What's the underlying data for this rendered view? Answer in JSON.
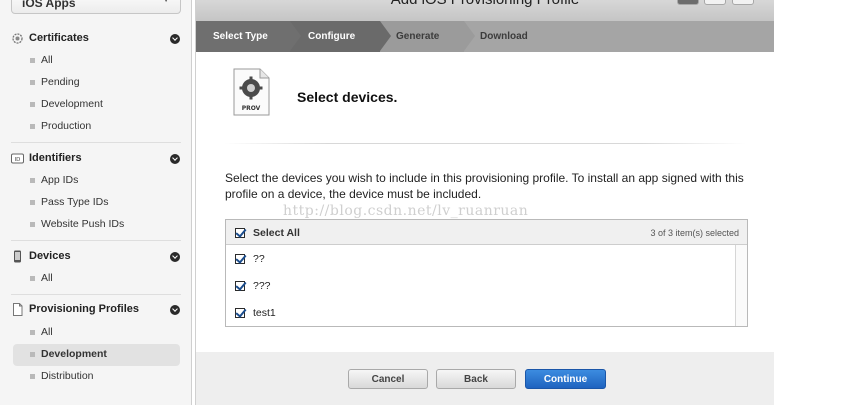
{
  "sidebar": {
    "app_select": "iOS Apps",
    "sections": [
      {
        "title": "Certificates",
        "icon": "certificate-icon",
        "items": [
          "All",
          "Pending",
          "Development",
          "Production"
        ]
      },
      {
        "title": "Identifiers",
        "icon": "id-badge-icon",
        "items": [
          "App IDs",
          "Pass Type IDs",
          "Website Push IDs"
        ]
      },
      {
        "title": "Devices",
        "icon": "device-icon",
        "items": [
          "All"
        ]
      },
      {
        "title": "Provisioning Profiles",
        "icon": "document-icon",
        "items": [
          "All",
          "Development",
          "Distribution"
        ],
        "active_item": "Development"
      }
    ]
  },
  "window": {
    "title": "Add iOS Provisioning Profile"
  },
  "steps": [
    {
      "label": "Select Type",
      "state": "done"
    },
    {
      "label": "Configure",
      "state": "current"
    },
    {
      "label": "Generate",
      "state": "todo"
    },
    {
      "label": "Download",
      "state": "todo"
    }
  ],
  "content": {
    "icon_label": "PROV",
    "title": "Select devices.",
    "instructions": "Select the devices you wish to include in this provisioning profile. To install an app signed with this profile on a device, the device must be included.",
    "watermark": "http://blog.csdn.net/lv_ruanruan"
  },
  "device_table": {
    "select_all_label": "Select All",
    "count_label": "3 of 3 item(s) selected",
    "devices": [
      {
        "name": "??",
        "checked": true
      },
      {
        "name": "???",
        "checked": true
      },
      {
        "name": "test1",
        "checked": true
      }
    ]
  },
  "buttons": {
    "cancel": "Cancel",
    "back": "Back",
    "continue": "Continue"
  },
  "colors": {
    "primary_button": "#1f63bf",
    "step_bar": "#6f6f6f"
  }
}
